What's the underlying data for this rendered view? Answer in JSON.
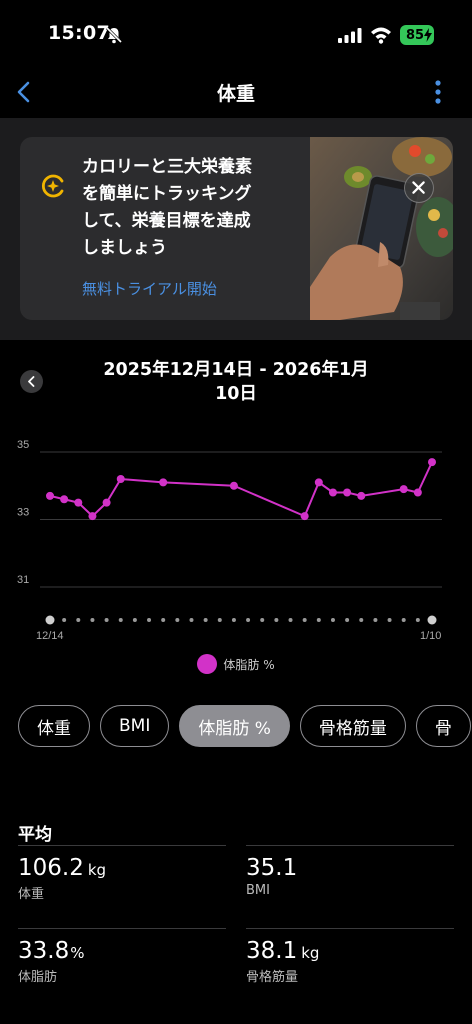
{
  "status_bar": {
    "time": "15:07",
    "battery": "85"
  },
  "nav": {
    "title": "体重"
  },
  "promo": {
    "text": "カロリーと三大栄養素\nを簡単にトラッキング\nして、栄養目標を達成\nしましょう",
    "link": "無料トライアル開始"
  },
  "range": {
    "title": "2025年12月14日 - 2026年1月\n10日"
  },
  "chart_data": {
    "type": "line",
    "x": [
      "12/14",
      "12/15",
      "12/16",
      "12/17",
      "12/18",
      "12/19",
      "12/22",
      "12/27",
      "1/1",
      "1/2",
      "1/3",
      "1/4",
      "1/5",
      "1/8",
      "1/9",
      "1/10"
    ],
    "series": [
      {
        "name": "体脂肪 %",
        "values": [
          33.7,
          33.6,
          33.5,
          33.1,
          33.5,
          34.2,
          34.1,
          34.0,
          33.1,
          34.1,
          33.8,
          33.8,
          33.7,
          33.9,
          33.8,
          34.7
        ],
        "color": "#d232c8"
      }
    ],
    "y_ticks": [
      35,
      33,
      31
    ],
    "ylim": [
      30,
      35.5
    ],
    "x_tick_labels": [
      "12/14",
      "1/10"
    ],
    "grid": true
  },
  "legend": {
    "label": "体脂肪 %"
  },
  "tabs": [
    {
      "label": "体重",
      "active": false
    },
    {
      "label": "BMI",
      "active": false
    },
    {
      "label": "体脂肪 %",
      "active": true
    },
    {
      "label": "骨格筋量",
      "active": false
    },
    {
      "label": "骨",
      "active": false
    }
  ],
  "averages": {
    "heading": "平均",
    "items": [
      {
        "value": "106.2",
        "unit": "kg",
        "label": "体重"
      },
      {
        "value": "35.1",
        "unit": "",
        "label": "BMI"
      },
      {
        "value": "33.8",
        "unit": "%",
        "label": "体脂肪"
      },
      {
        "value": "38.1",
        "unit": "kg",
        "label": "骨格筋量"
      }
    ]
  }
}
